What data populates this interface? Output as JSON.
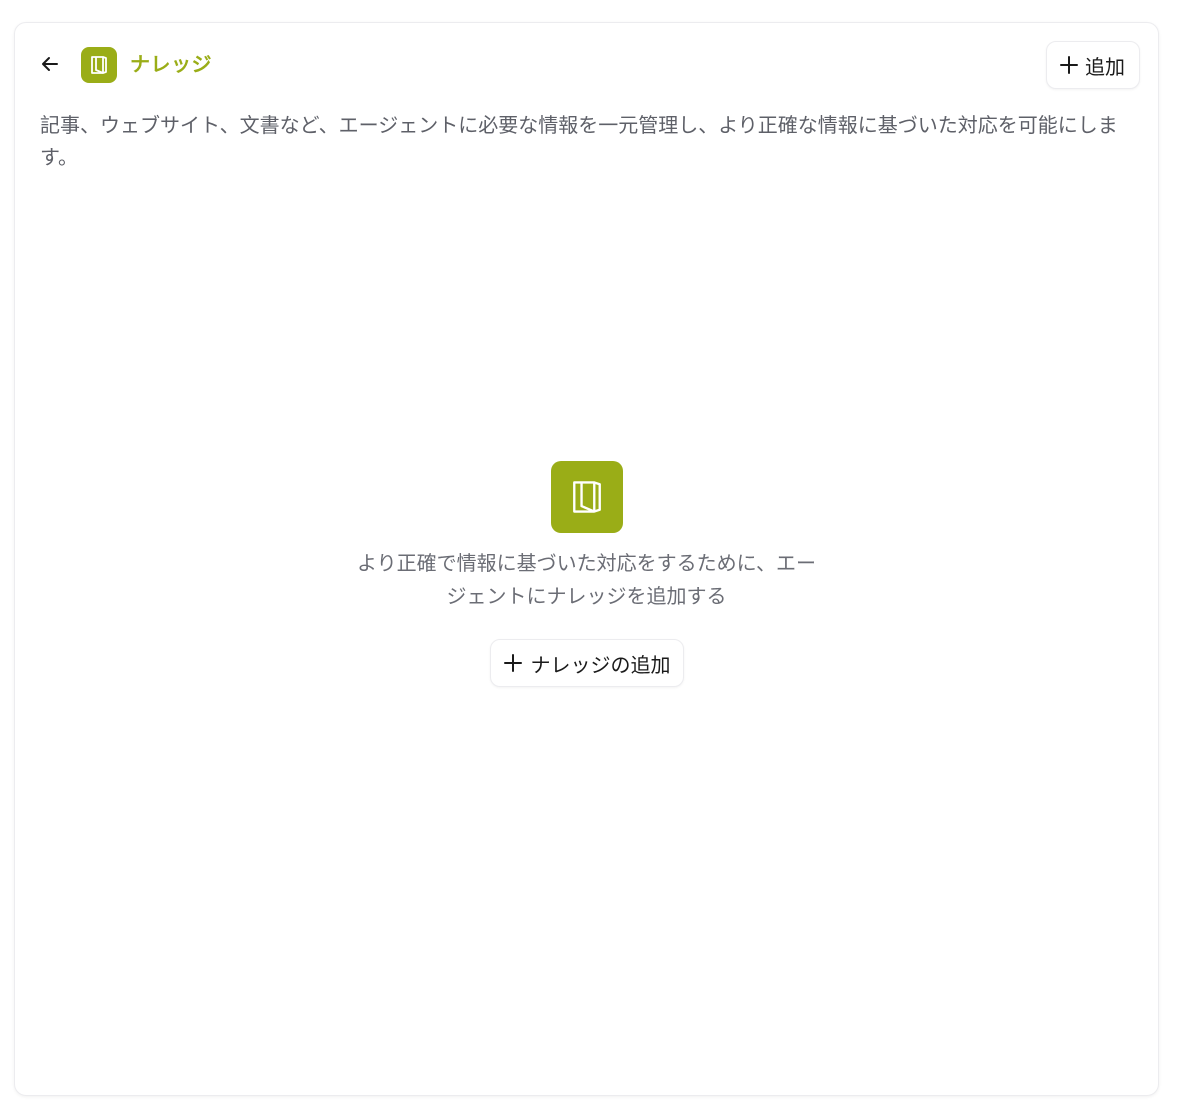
{
  "colors": {
    "accent": "#9aad17",
    "text_primary": "#1a1a1a",
    "text_secondary": "#5e6068"
  },
  "header": {
    "back_icon": "arrow-left-icon",
    "title_icon": "book-icon",
    "title": "ナレッジ",
    "add_button": {
      "icon": "plus-icon",
      "label": "追加"
    }
  },
  "description": "記事、ウェブサイト、文書など、エージェントに必要な情報を一元管理し、より正確な情報に基づいた対応を可能にします。",
  "empty_state": {
    "icon": "book-icon",
    "message": "より正確で情報に基づいた対応をするために、エージェントにナレッジを追加する",
    "button": {
      "icon": "plus-icon",
      "label": "ナレッジの追加"
    }
  }
}
